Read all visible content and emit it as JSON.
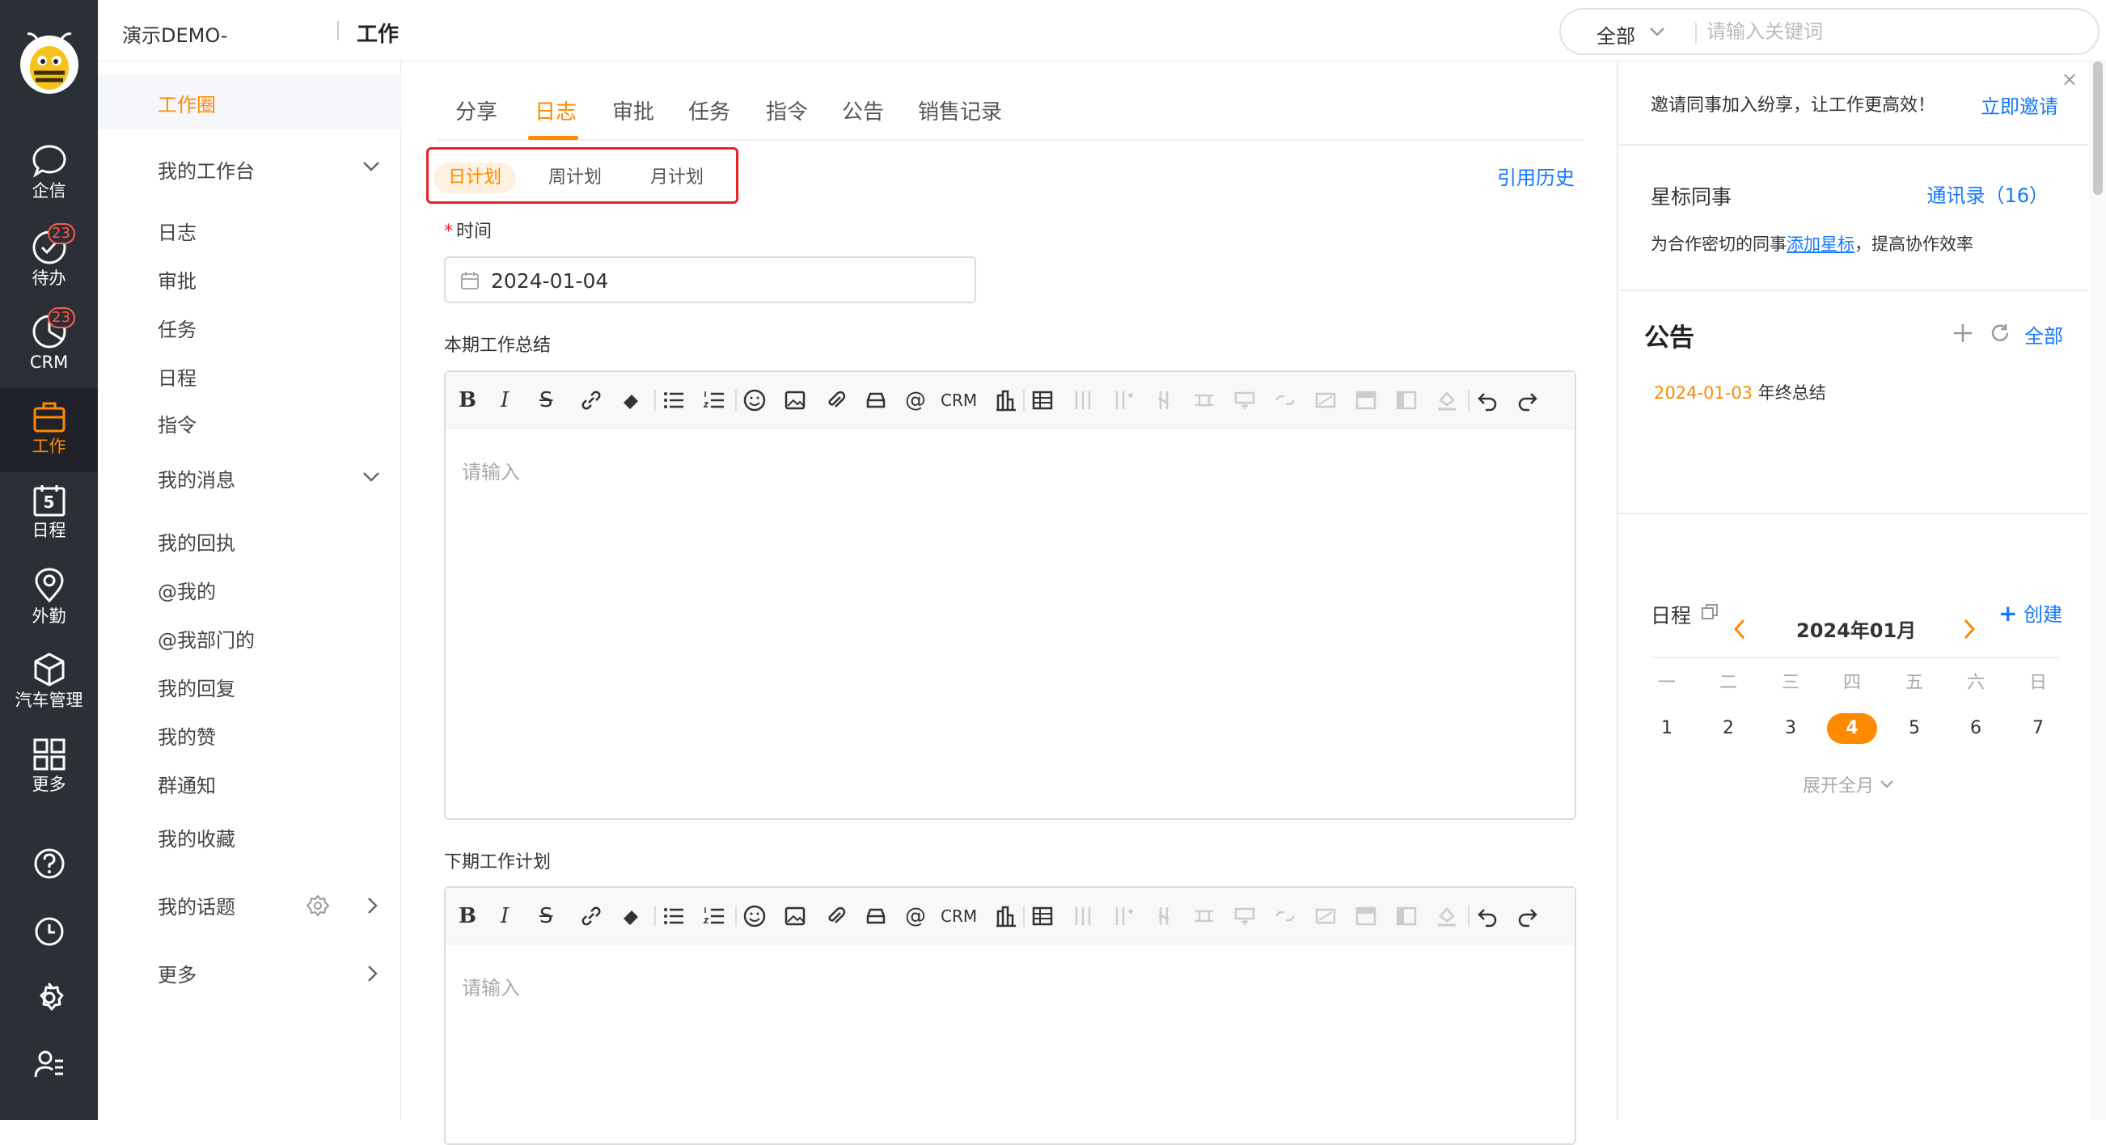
{
  "header": {
    "org": "演示DEMO-",
    "title": "工作",
    "search_scope": "全部",
    "search_placeholder": "请输入关键词"
  },
  "rail": {
    "items": [
      {
        "label": "企信",
        "icon": "chat-bubble-icon"
      },
      {
        "label": "待办",
        "icon": "check-circle-icon",
        "badge": "23"
      },
      {
        "label": "CRM",
        "icon": "pie-chart-icon",
        "badge": "23"
      },
      {
        "label": "工作",
        "icon": "briefcase-icon",
        "active": true
      },
      {
        "label": "日程",
        "icon": "calendar-icon",
        "day": "5"
      },
      {
        "label": "外勤",
        "icon": "location-pin-icon"
      },
      {
        "label": "汽车管理",
        "icon": "cube-icon"
      },
      {
        "label": "更多",
        "icon": "grid-icon"
      }
    ],
    "bottom_icons": [
      "help-icon",
      "clock-icon",
      "settings-icon",
      "user-list-icon"
    ]
  },
  "nav": {
    "active": "工作圈",
    "my_workbench": "我的工作台",
    "workbench_items": [
      "日志",
      "审批",
      "任务",
      "日程",
      "指令"
    ],
    "my_messages": "我的消息",
    "message_items": [
      "我的回执",
      "@我的",
      "@我部门的",
      "我的回复",
      "我的赞",
      "群通知"
    ],
    "favorites": "我的收藏",
    "topics": "我的话题",
    "more": "更多"
  },
  "main": {
    "tabs": [
      "分享",
      "日志",
      "审批",
      "任务",
      "指令",
      "公告",
      "销售记录"
    ],
    "active_tab": "日志",
    "plan_tabs": [
      "日计划",
      "周计划",
      "月计划"
    ],
    "active_plan": "日计划",
    "history_link": "引用历史",
    "time_label": "时间",
    "date_value": "2024-01-04",
    "summary_label": "本期工作总结",
    "next_label": "下期工作计划",
    "editor_placeholder": "请输入",
    "toolbar_crm": "CRM"
  },
  "right": {
    "invite_text": "邀请同事加入纷享，让工作更高效！",
    "invite_link": "立即邀请",
    "close": "×",
    "star_title": "星标同事",
    "contacts_link": "通讯录（16）",
    "star_hint_prefix": "为合作密切的同事",
    "star_hint_link": "添加星标",
    "star_hint_suffix": "，提高协作效率",
    "notice_title": "公告",
    "notice_all": "全部",
    "notice_item_date": "2024-01-03",
    "notice_item_title": "年终总结",
    "schedule_title": "日程",
    "schedule_create": "创建",
    "month": "2024年01月",
    "weekdays": [
      "一",
      "二",
      "三",
      "四",
      "五",
      "六",
      "日"
    ],
    "days": [
      "1",
      "2",
      "3",
      "4",
      "5",
      "6",
      "7"
    ],
    "today": "4",
    "expand": "展开全月"
  },
  "colors": {
    "accent": "#ff8a00",
    "link": "#1677ff",
    "rail": "#2b2f36",
    "highlight_box": "#e6232a"
  }
}
